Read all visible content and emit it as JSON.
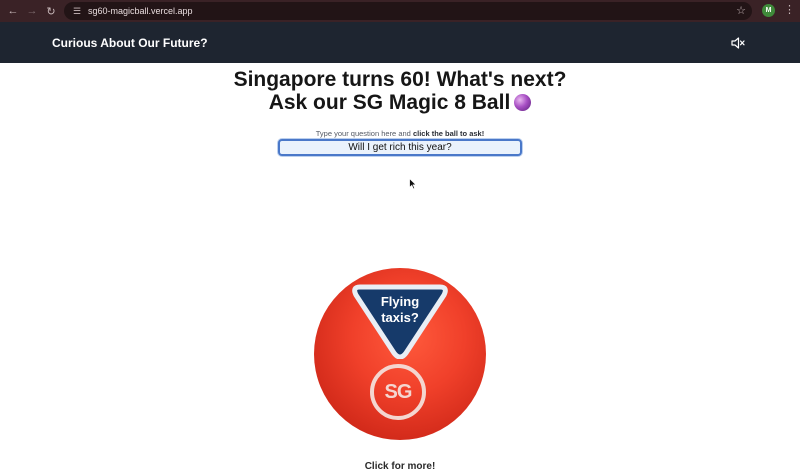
{
  "browser": {
    "url": "sg60-magicball.vercel.app",
    "profile_initial": "M",
    "icons": [
      "back-icon",
      "forward-icon",
      "reload-icon",
      "site-info-icon",
      "star-icon",
      "menu-icon"
    ]
  },
  "header": {
    "title": "Curious About Our Future?",
    "mute_icon": "speaker-muted-icon"
  },
  "main": {
    "heading_line1": "Singapore turns 60! What's next?",
    "heading_line2": "Ask our SG Magic 8 Ball",
    "hint_prefix": "Type your question here and",
    "hint_bold": "click the ball to ask!",
    "question_value": "Will I get rich this year?",
    "ball_answer_line1": "Flying",
    "ball_answer_line2": "taxis?",
    "ball_logo": "SG",
    "click_more": "Click for more!"
  },
  "colors": {
    "header_bg": "#1e2530",
    "ball_red": "#f0402a",
    "answer_window": "#163a6a",
    "input_border": "#4a78c9"
  }
}
